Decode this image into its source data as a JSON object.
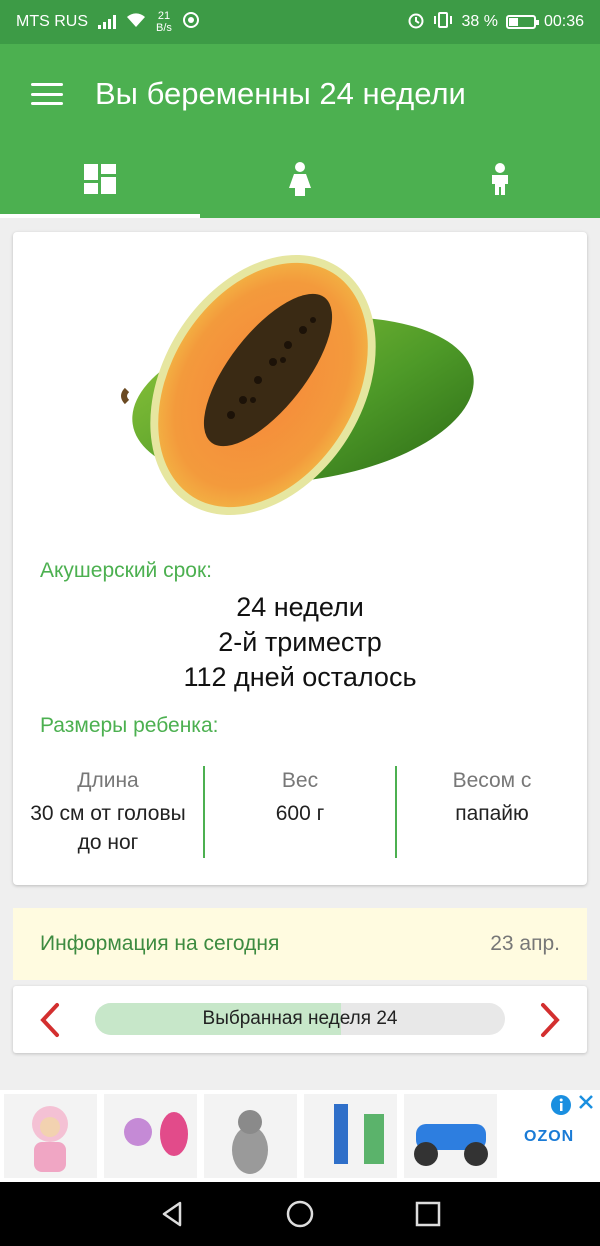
{
  "status_bar": {
    "carrier": "MTS RUS",
    "speed_value": "21",
    "speed_unit": "B/s",
    "battery": "38 %",
    "battery_level": 0.38,
    "time": "00:36"
  },
  "toolbar": {
    "title": "Вы беременны 24 недели"
  },
  "tabs": [
    {
      "icon": "dashboard-icon",
      "active": true
    },
    {
      "icon": "woman-icon",
      "active": false
    },
    {
      "icon": "child-icon",
      "active": false
    }
  ],
  "main_card": {
    "image": "papaya-image",
    "obstetric_label": "Акушерский срок:",
    "weeks": "24 недели",
    "trimester": "2-й триместр",
    "days_left": "112 дней осталось",
    "sizes_label": "Размеры ребенка:",
    "sizes": [
      {
        "heading": "Длина",
        "value": "30 см от головы до ног"
      },
      {
        "heading": "Вес",
        "value": "600 г"
      },
      {
        "heading": "Весом с",
        "value": "папайю"
      }
    ]
  },
  "info_today": {
    "label": "Информация на сегодня",
    "date": "23 апр."
  },
  "week_selector": {
    "label": "Выбранная неделя 24",
    "progress": 0.6
  },
  "ad": {
    "brand": "OZON"
  },
  "colors": {
    "primary": "#4cb050",
    "status_bar": "#3d9b46",
    "arrow": "#d32f2f",
    "info_bg": "#fffbe0"
  }
}
